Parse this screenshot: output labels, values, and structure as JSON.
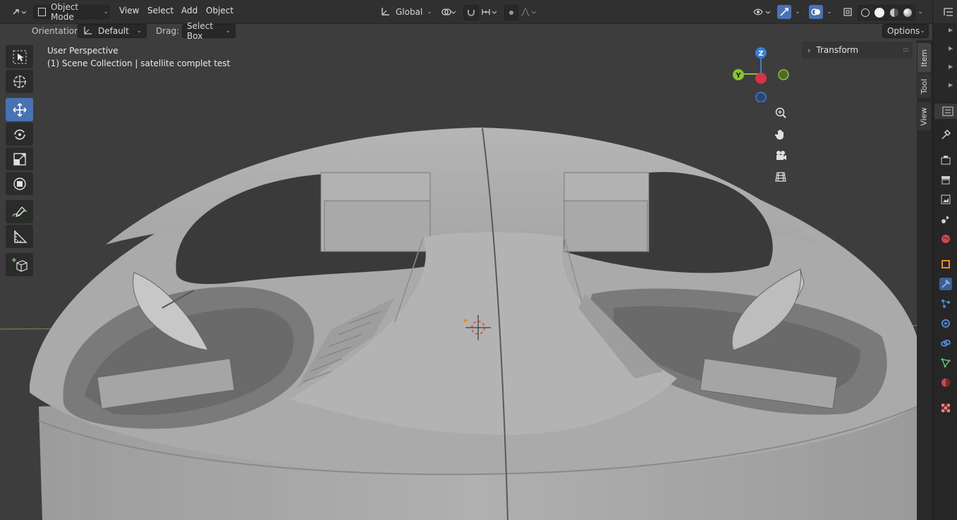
{
  "header": {
    "mode_label": "Object Mode",
    "menus": [
      "View",
      "Select",
      "Add",
      "Object"
    ],
    "transform_orientation": "Global"
  },
  "toolsettings": {
    "orientation_label": "Orientation:",
    "orientation_value": "Default",
    "drag_label": "Drag:",
    "drag_value": "Select Box",
    "options_label": "Options"
  },
  "viewport": {
    "perspective_label": "User Perspective",
    "collection_label": "(1) Scene Collection | satellite complet test",
    "gizmo": {
      "z": "Z",
      "y": "Y"
    }
  },
  "sidebar": {
    "panel_title": "Transform",
    "tabs": [
      "Item",
      "Tool",
      "View"
    ]
  },
  "colors": {
    "accent": "#4772b3",
    "axis_x": "#d6334a",
    "axis_y": "#8bc232",
    "axis_z": "#3a7fd6",
    "grid_line": "#6e9a3a"
  },
  "icons": {
    "toolbar": [
      "select-box-icon",
      "cursor-icon",
      "move-icon",
      "rotate-icon",
      "scale-icon",
      "transform-icon",
      "annotate-icon",
      "measure-icon",
      "add-cube-icon"
    ],
    "nav": [
      "zoom-icon",
      "pan-hand-icon",
      "camera-icon",
      "ortho-grid-icon"
    ]
  }
}
